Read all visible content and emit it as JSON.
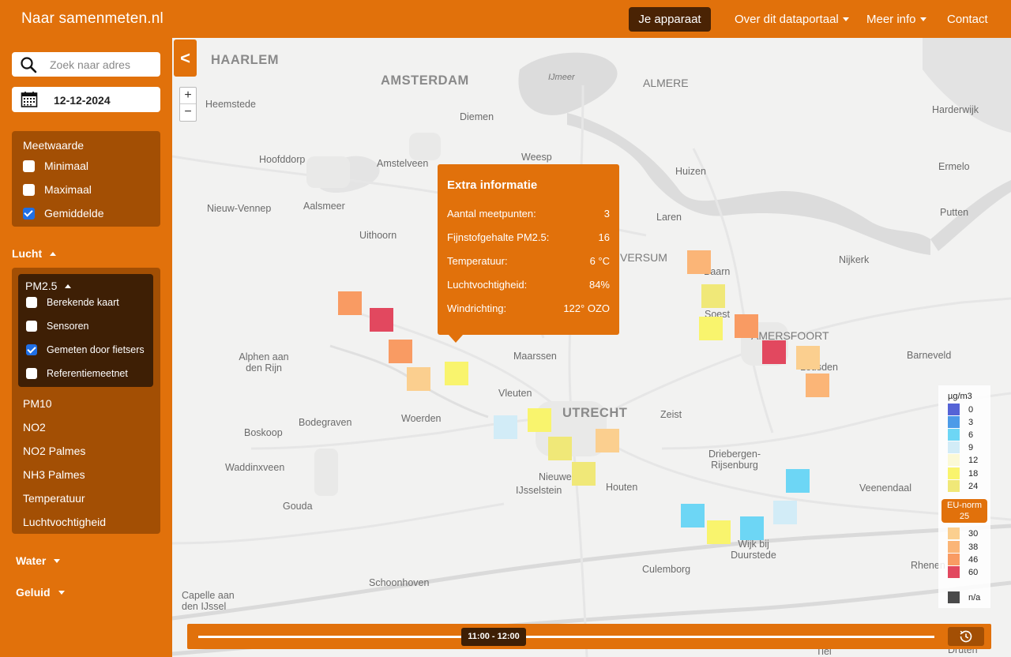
{
  "header": {
    "brand": "Naar samenmeten.nl",
    "device_button": "Je apparaat",
    "nav": [
      {
        "label": "Over dit dataportaal"
      },
      {
        "label": "Meer info"
      },
      {
        "label": "Contact"
      }
    ]
  },
  "sidebar": {
    "search_placeholder": "Zoek naar adres",
    "date": "12-12-2024",
    "measure_panel": {
      "title": "Meetwaarde",
      "options": [
        {
          "label": "Minimaal",
          "checked": false
        },
        {
          "label": "Maximaal",
          "checked": false
        },
        {
          "label": "Gemiddelde",
          "checked": true
        }
      ]
    },
    "lucht": {
      "label": "Lucht",
      "pm25": {
        "label": "PM2.5",
        "options": [
          {
            "label": "Berekende kaart",
            "checked": false
          },
          {
            "label": "Sensoren",
            "checked": false
          },
          {
            "label": "Gemeten door fietsers",
            "checked": true
          },
          {
            "label": "Referentiemeetnet",
            "checked": false
          }
        ]
      },
      "items": [
        "PM10",
        "NO2",
        "NO2 Palmes",
        "NH3 Palmes",
        "Temperatuur",
        "Luchtvochtigheid"
      ]
    },
    "water": {
      "label": "Water"
    },
    "geluid": {
      "label": "Geluid"
    }
  },
  "map": {
    "collapse_symbol": "<",
    "zoom_in": "+",
    "zoom_out": "−",
    "places": [
      "HAARLEM",
      "AMSTERDAM",
      "IJmeer",
      "ALMERE",
      "Heemstede",
      "Diemen",
      "Harderwijk",
      "Hoofddorp",
      "Amstelveen",
      "Weesp",
      "Huizen",
      "Ermelo",
      "Nieuw-Vennep",
      "Aalsmeer",
      "Laren",
      "Putten",
      "Uithoorn",
      "Nijkerk",
      "VERSUM",
      "Baarn",
      "Soest",
      "AMERSFOORT",
      "Alphen aan den Rijn",
      "Maarssen",
      "Barneveld",
      "Leusden",
      "Vleuten",
      "Bodegraven",
      "Woerden",
      "UTRECHT",
      "Zeist",
      "Boskoop",
      "Driebergen-Rijsenburg",
      "Waddinxveen",
      "Nieuwegein",
      "IJsselstein",
      "Houten",
      "Veenendaal",
      "Gouda",
      "Wijk bij Duurstede",
      "Rhenen",
      "Culemborg",
      "Schoonhoven",
      "Capelle aan den IJssel",
      "Tiel",
      "Druten"
    ]
  },
  "popup": {
    "title": "Extra informatie",
    "rows": [
      {
        "label": "Aantal meetpunten:",
        "value": "3"
      },
      {
        "label": "Fijnstofgehalte PM2.5:",
        "value": "16"
      },
      {
        "label": "Temperatuur:",
        "value": "6 °C"
      },
      {
        "label": "Luchtvochtigheid:",
        "value": "84%"
      },
      {
        "label": "Windrichting:",
        "value": "122° OZO"
      }
    ]
  },
  "legend": {
    "unit": "µg/m3",
    "items": [
      {
        "label": "0",
        "color": "#5563d6"
      },
      {
        "label": "3",
        "color": "#4c9be8"
      },
      {
        "label": "6",
        "color": "#6dd6f5"
      },
      {
        "label": "9",
        "color": "#d2ecf7"
      },
      {
        "label": "12",
        "color": "#fbf9d6"
      },
      {
        "label": "18",
        "color": "#f9f46d"
      },
      {
        "label": "24",
        "color": "#f0e878"
      },
      {
        "label": "30",
        "color": "#fbcf8f"
      },
      {
        "label": "38",
        "color": "#fbb577"
      },
      {
        "label": "46",
        "color": "#f99b63"
      },
      {
        "label": "60",
        "color": "#e2485f"
      },
      {
        "label": "n/a",
        "color": "#4a4a4a"
      }
    ],
    "eu_norm_label": "EU-norm",
    "eu_norm_value": "25"
  },
  "timeline": {
    "current": "11:00 - 12:00"
  },
  "colors": {
    "brand_orange": "#e1710b",
    "panel_brown": "#a34f04",
    "dark_brown": "#3e1f05"
  }
}
